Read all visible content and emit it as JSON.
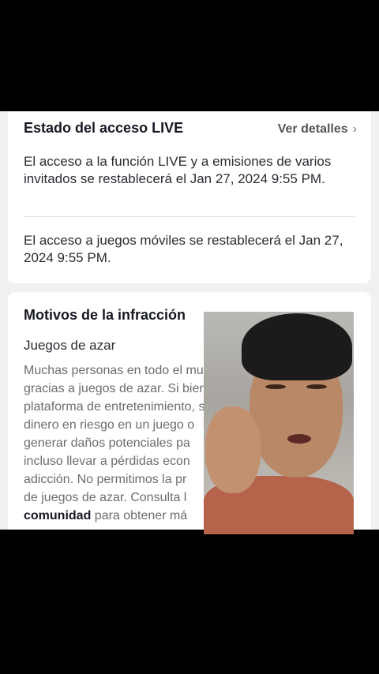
{
  "access_status": {
    "title": "Estado del acceso LIVE",
    "details_link": "Ver detalles",
    "live_notice": "El acceso a la función LIVE y a emisiones de varios invitados se restablecerá el Jan 27, 2024 9:55 PM.",
    "games_notice": "El acceso a juegos móviles se restablecerá el Jan 27, 2024 9:55 PM."
  },
  "violation": {
    "title": "Motivos de la infracción",
    "category": "Juegos de azar",
    "description_lines": [
      "Muchas personas en todo el mund",
      "gracias a juegos de azar. Si bien Ti",
      "plataforma de entretenimiento, sa",
      "dinero en riesgo en un juego o",
      "generar daños potenciales pa",
      "incluso llevar a pérdidas econ",
      "adicción. No permitimos la pr",
      "de juegos de azar. Consulta l"
    ],
    "bold_link": "comunidad",
    "tail_text": " para obtener má"
  },
  "icons": {
    "chevron": "chevron-right-icon"
  }
}
